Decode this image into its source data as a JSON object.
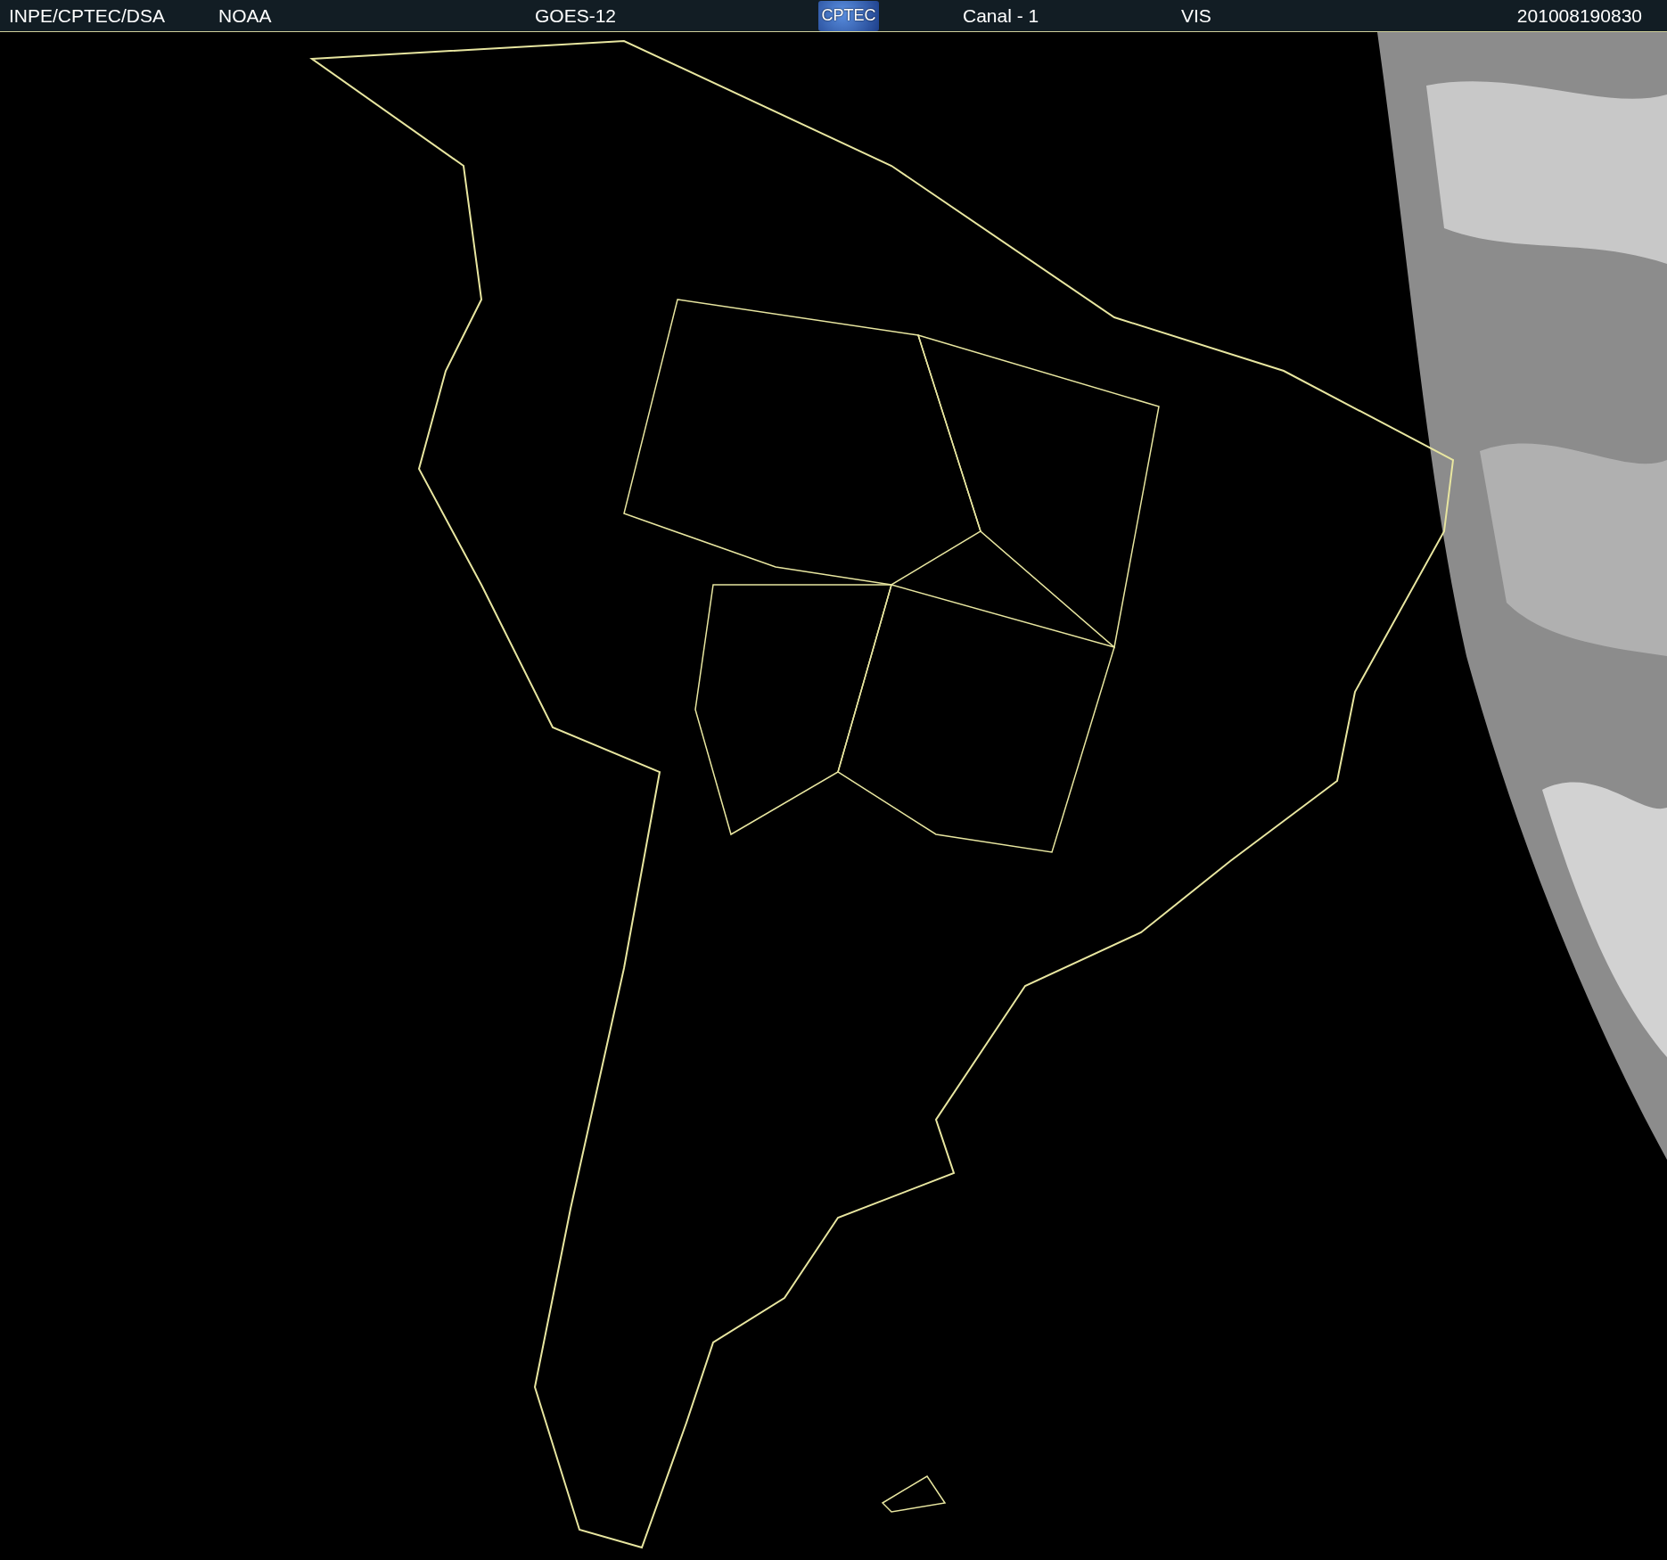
{
  "header": {
    "source": "INPE/CPTEC/DSA",
    "agency": "NOAA",
    "satellite": "GOES-12",
    "logo": "CPTEC",
    "channel": "Canal - 1",
    "band": "VIS",
    "timestamp": "201008190830"
  }
}
